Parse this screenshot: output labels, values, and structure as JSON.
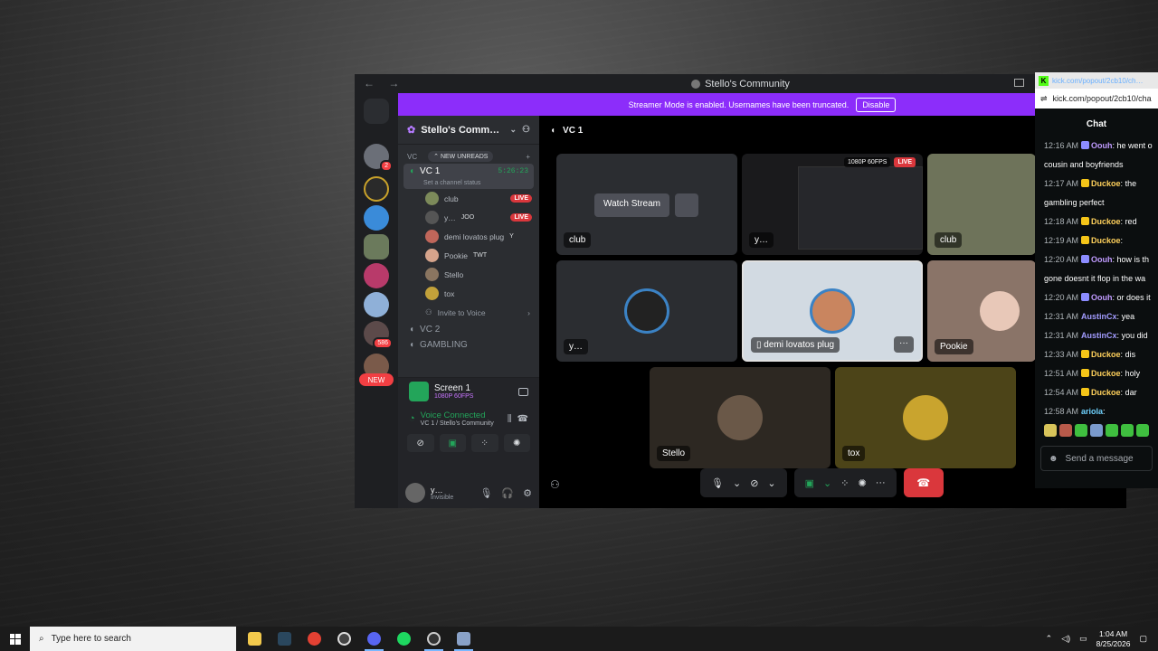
{
  "discord": {
    "nav_arrows": "← →",
    "title": "Stello's Community",
    "banner": {
      "text": "Streamer Mode is enabled. Usernames have been truncated.",
      "button": "Disable"
    },
    "guild_badges": {
      "home": "2",
      "g6": "586",
      "new": "NEW"
    },
    "server": {
      "name": "Stello's Comm…",
      "vc_category": "VC",
      "new_unreads": "NEW UNREADS",
      "active_channel": {
        "name": "VC 1",
        "timer": "5:26:23",
        "status": "Set a channel status"
      },
      "voice_users": [
        {
          "name": "club",
          "tag": "",
          "live": "LIVE",
          "color": "#7c8a5a"
        },
        {
          "name": "y…",
          "tag": "JOO",
          "live": "LIVE",
          "color": "#555"
        },
        {
          "name": "demi lovatos plug",
          "tag": "Y",
          "live": "",
          "color": "#c0665a"
        },
        {
          "name": "Pookie",
          "tag": "TWT",
          "live": "",
          "color": "#d6a48c"
        },
        {
          "name": "Stello",
          "tag": "",
          "live": "",
          "color": "#8a7560"
        },
        {
          "name": "tox",
          "tag": "",
          "live": "",
          "color": "#c2a13a"
        }
      ],
      "invite": "Invite to Voice",
      "channels": [
        "VC 2",
        "GAMBLING"
      ]
    },
    "panel": {
      "screen_title": "Screen 1",
      "screen_sub": "1080P 60FPS",
      "voice_connected": "Voice Connected",
      "voice_location": "VC 1 / Stello's Community",
      "user_name": "y…",
      "user_status": "Invisible"
    },
    "stage": {
      "channel": "VC 1",
      "watch_stream": "Watch Stream",
      "resolution": "1080P 60FPS",
      "live": "LIVE",
      "tiles": [
        "club",
        "y…",
        "club",
        "y…",
        "demi lovatos plug",
        "Pookie",
        "Stello",
        "tox"
      ],
      "more": "···"
    }
  },
  "chat": {
    "title_url": "kick.com/popout/2cb10/ch…",
    "url": "kick.com/popout/2cb10/cha",
    "header": "Chat",
    "messages": [
      {
        "time": "12:16 AM",
        "user": "Oouh",
        "text": "he went o",
        "ucolor": "#c09bff",
        "badge": "#8c8cff"
      },
      {
        "time": "",
        "user": "",
        "text": "cousin and boyfriends",
        "ucolor": "#fff",
        "badge": ""
      },
      {
        "time": "12:17 AM",
        "user": "Duckoe",
        "text": "the",
        "ucolor": "#ffd15c",
        "badge": "#f5c518"
      },
      {
        "time": "",
        "user": "",
        "text": "gambling perfect",
        "ucolor": "#fff",
        "badge": ""
      },
      {
        "time": "12:18 AM",
        "user": "Duckoe",
        "text": "red",
        "ucolor": "#ffd15c",
        "badge": "#f5c518"
      },
      {
        "time": "12:19 AM",
        "user": "Duckoe",
        "text": "",
        "ucolor": "#ffd15c",
        "badge": "#f5c518"
      },
      {
        "time": "12:20 AM",
        "user": "Oouh",
        "text": "how is th",
        "ucolor": "#c09bff",
        "badge": "#8c8cff"
      },
      {
        "time": "",
        "user": "",
        "text": "gone doesnt it flop in the wa",
        "ucolor": "#fff",
        "badge": ""
      },
      {
        "time": "12:20 AM",
        "user": "Oouh",
        "text": "or does it",
        "ucolor": "#c09bff",
        "badge": "#8c8cff"
      },
      {
        "time": "12:31 AM",
        "user": "AustinCx",
        "text": "yea",
        "ucolor": "#a39cff",
        "badge": ""
      },
      {
        "time": "12:31 AM",
        "user": "AustinCx",
        "text": "you did",
        "ucolor": "#a39cff",
        "badge": ""
      },
      {
        "time": "12:33 AM",
        "user": "Duckoe",
        "text": "dis",
        "ucolor": "#ffd15c",
        "badge": "#f5c518"
      },
      {
        "time": "12:51 AM",
        "user": "Duckoe",
        "text": "holy",
        "ucolor": "#ffd15c",
        "badge": "#f5c518"
      },
      {
        "time": "12:54 AM",
        "user": "Duckoe",
        "text": "dar",
        "ucolor": "#ffd15c",
        "badge": "#f5c518"
      },
      {
        "time": "12:58 AM",
        "user": "ariola",
        "text": "",
        "ucolor": "#6fd3ff",
        "badge": ""
      }
    ],
    "send_placeholder": "Send a message"
  },
  "taskbar": {
    "search_placeholder": "Type here to search",
    "time": "1:04 AM",
    "date": "8/25/2026"
  },
  "colors": {
    "accent": "#8c2dfa",
    "green": "#23a55a",
    "red": "#da373c",
    "kick": "#53fc18"
  }
}
